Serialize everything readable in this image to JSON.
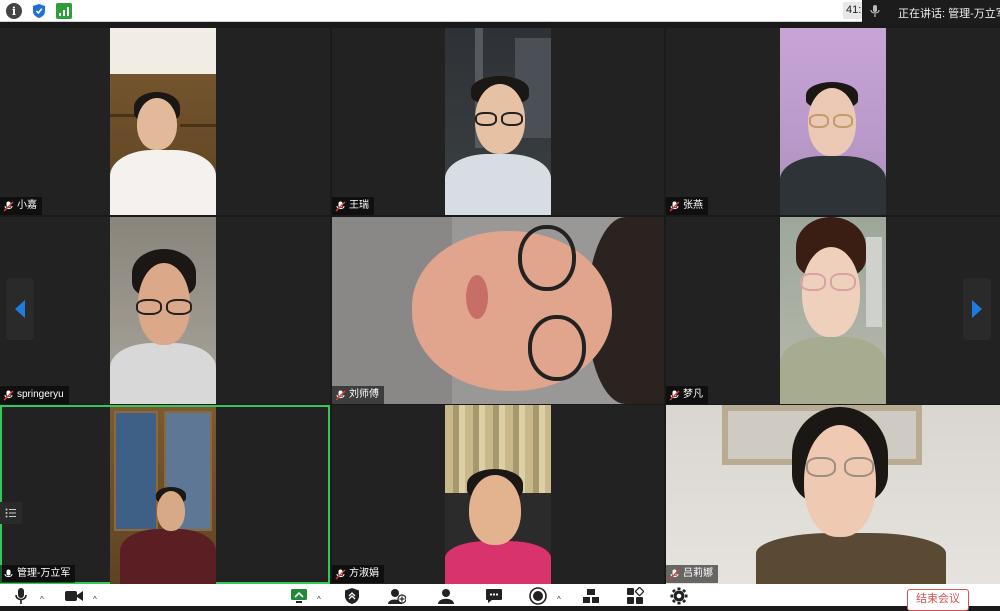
{
  "topbar": {
    "time_badge": "41:",
    "speaking_label": "正在讲话: 管理-万立军;"
  },
  "participants": [
    {
      "name": "小嘉"
    },
    {
      "name": "王瑞"
    },
    {
      "name": "张燕"
    },
    {
      "name": "springeryu"
    },
    {
      "name": "刘师傅"
    },
    {
      "name": "梦凡"
    },
    {
      "name": "管理-万立军"
    },
    {
      "name": "方淑娟"
    },
    {
      "name": "吕莉娜"
    }
  ],
  "toolbar": {
    "end_meeting_label": "结束会议"
  },
  "icons": {
    "info": "info-icon",
    "shield": "shield-icon",
    "signal": "signal-icon",
    "mic": "microphone-icon",
    "video": "video-camera-icon",
    "share": "share-screen-icon",
    "security": "security-icon",
    "invite": "add-participant-icon",
    "participants": "participants-icon",
    "chat": "chat-icon",
    "record": "record-icon",
    "breakout": "breakout-rooms-icon",
    "apps": "apps-icon",
    "settings": "settings-gear-icon"
  },
  "colors": {
    "active_speaker_border": "#35c759",
    "end_button": "#d9534f",
    "nav_arrow": "#1e7be0",
    "shield_blue": "#1f6fd6",
    "signal_green": "#2e9e3b"
  }
}
